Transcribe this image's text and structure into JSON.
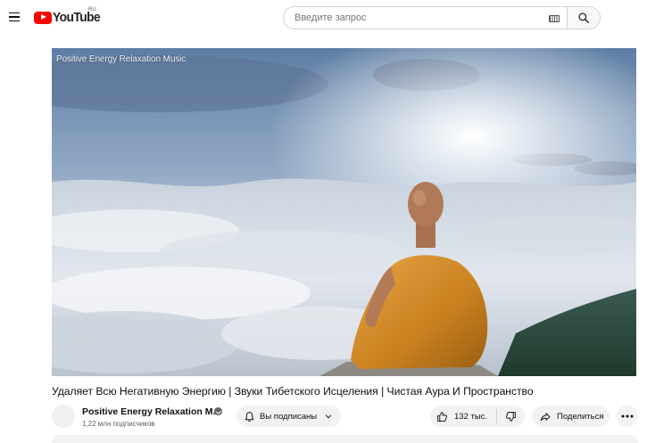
{
  "header": {
    "logo_text": "YouTube",
    "region": "RU",
    "search_placeholder": "Введите запрос"
  },
  "video": {
    "watermark": "Positive Energy Relaxation Music",
    "title": "Удаляет Всю Негативную Энергию | Звуки Тибетского Исцеления | Чистая Аура И Пространство"
  },
  "channel": {
    "name": "Positive Energy Relaxation M...",
    "subscribers": "1,22 млн подписчиков",
    "subscribed_label": "Вы подписаны"
  },
  "actions": {
    "likes": "132 тыс.",
    "share_label": "Поделиться"
  },
  "icons": {
    "menu": "hamburger-icon",
    "search": "search-icon",
    "keyboard": "keyboard-icon",
    "bell": "bell-icon",
    "chevron": "chevron-down-icon",
    "like": "thumbs-up-icon",
    "dislike": "thumbs-down-icon",
    "share": "share-icon",
    "more": "more-horizontal-icon",
    "verified": "verified-check-icon"
  },
  "colors": {
    "brand_red": "#ff0000",
    "pill_bg": "#f2f2f2",
    "text_secondary": "#606060"
  }
}
